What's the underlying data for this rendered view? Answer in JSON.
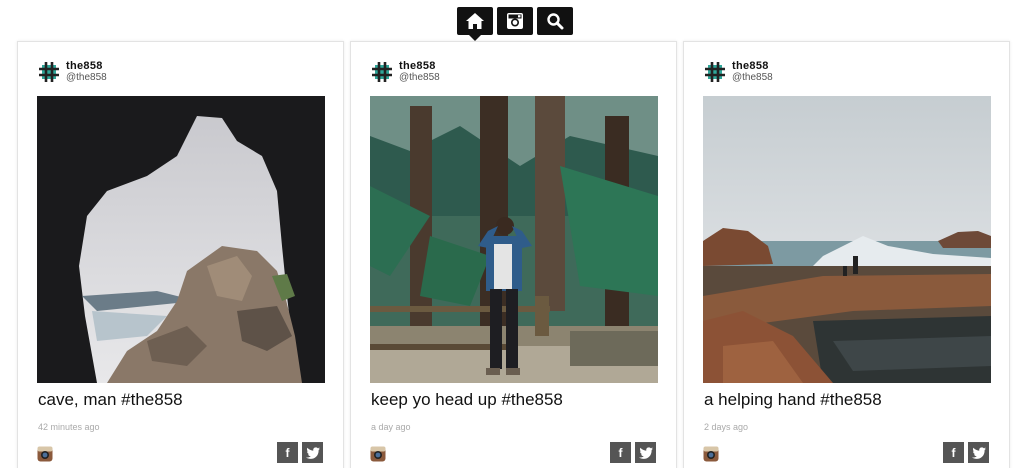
{
  "nav": {
    "items": [
      {
        "name": "home-icon",
        "active": true
      },
      {
        "name": "instagram-icon",
        "active": false
      },
      {
        "name": "search-icon",
        "active": false
      }
    ]
  },
  "posts": [
    {
      "user": {
        "name": "the858",
        "handle": "@the858",
        "avatar_icon": "hashtag-icon"
      },
      "caption": "cave, man #the858",
      "time": "42 minutes ago",
      "photo_subject": "sea cave opening onto rocky coast",
      "share": {
        "facebook_label": "f",
        "twitter_icon": "twitter-icon"
      }
    },
    {
      "user": {
        "name": "the858",
        "handle": "@the858",
        "avatar_icon": "hashtag-icon"
      },
      "caption": "keep yo head up #the858",
      "time": "a day ago",
      "photo_subject": "person in redwood forest looking up",
      "share": {
        "facebook_label": "f",
        "twitter_icon": "twitter-icon"
      }
    },
    {
      "user": {
        "name": "the858",
        "handle": "@the858",
        "avatar_icon": "hashtag-icon"
      },
      "caption": "a helping hand #the858",
      "time": "2 days ago",
      "photo_subject": "coastal ruins with crashing waves",
      "share": {
        "facebook_label": "f",
        "twitter_icon": "twitter-icon"
      }
    }
  ],
  "colors": {
    "nav_bg": "#111111",
    "share_bg": "#555555",
    "avatar_teal": "#2fa79a"
  }
}
